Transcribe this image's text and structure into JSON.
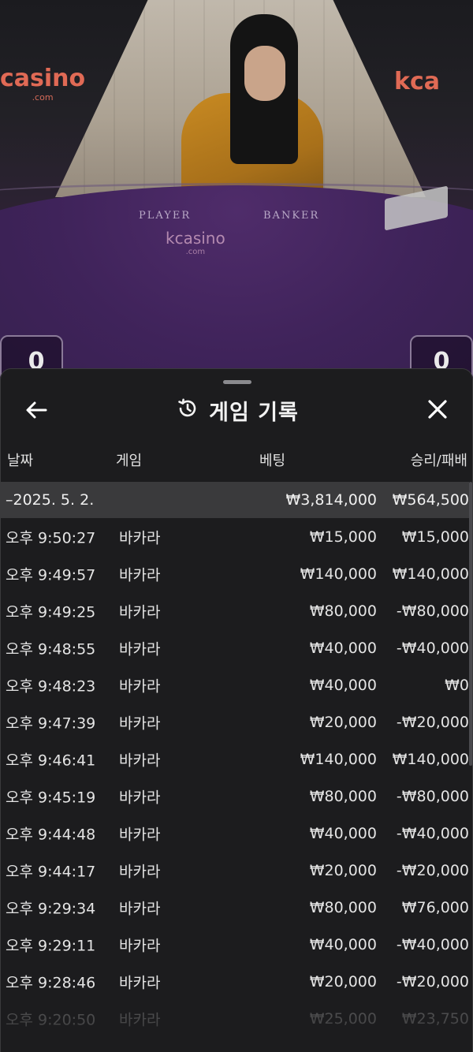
{
  "video": {
    "brand_left": "casino",
    "brand_left_sub": ".com",
    "brand_right": "kca",
    "brand_table": "kcasino",
    "brand_table_sub": ".com",
    "felt_player": "PLAYER",
    "felt_banker": "BANKER",
    "score_player": "0",
    "score_banker": "0"
  },
  "header": {
    "title": "게임 기록",
    "back_icon": "arrow-left-icon",
    "history_icon": "history-clock-icon",
    "close_icon": "close-x-icon"
  },
  "columns": {
    "date": "날짜",
    "game": "게임",
    "bet": "베팅",
    "win_loss": "승리/패배"
  },
  "date_group": {
    "date": "–2025. 5. 2.",
    "total_bet": "₩3,814,000",
    "total_win": "₩564,500"
  },
  "rows": [
    {
      "time": "오후 9:50:27",
      "game": "바카라",
      "bet": "₩15,000",
      "result": "₩15,000"
    },
    {
      "time": "오후 9:49:57",
      "game": "바카라",
      "bet": "₩140,000",
      "result": "₩140,000"
    },
    {
      "time": "오후 9:49:25",
      "game": "바카라",
      "bet": "₩80,000",
      "result": "-₩80,000"
    },
    {
      "time": "오후 9:48:55",
      "game": "바카라",
      "bet": "₩40,000",
      "result": "-₩40,000"
    },
    {
      "time": "오후 9:48:23",
      "game": "바카라",
      "bet": "₩40,000",
      "result": "₩0"
    },
    {
      "time": "오후 9:47:39",
      "game": "바카라",
      "bet": "₩20,000",
      "result": "-₩20,000"
    },
    {
      "time": "오후 9:46:41",
      "game": "바카라",
      "bet": "₩140,000",
      "result": "₩140,000"
    },
    {
      "time": "오후 9:45:19",
      "game": "바카라",
      "bet": "₩80,000",
      "result": "-₩80,000"
    },
    {
      "time": "오후 9:44:48",
      "game": "바카라",
      "bet": "₩40,000",
      "result": "-₩40,000"
    },
    {
      "time": "오후 9:44:17",
      "game": "바카라",
      "bet": "₩20,000",
      "result": "-₩20,000"
    },
    {
      "time": "오후 9:29:34",
      "game": "바카라",
      "bet": "₩80,000",
      "result": "₩76,000"
    },
    {
      "time": "오후 9:29:11",
      "game": "바카라",
      "bet": "₩40,000",
      "result": "-₩40,000"
    },
    {
      "time": "오후 9:28:46",
      "game": "바카라",
      "bet": "₩20,000",
      "result": "-₩20,000"
    },
    {
      "time": "오후 9:20:50",
      "game": "바카라",
      "bet": "₩25,000",
      "result": "₩23,750"
    }
  ]
}
